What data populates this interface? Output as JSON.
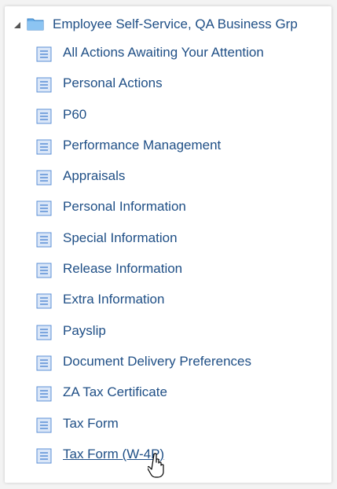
{
  "tree": {
    "root_label": "Employee Self-Service, QA Business Grp",
    "items": [
      {
        "label": "All Actions Awaiting Your Attention"
      },
      {
        "label": "Personal Actions"
      },
      {
        "label": "P60"
      },
      {
        "label": "Performance Management"
      },
      {
        "label": "Appraisals"
      },
      {
        "label": "Personal Information"
      },
      {
        "label": "Special Information"
      },
      {
        "label": "Release Information"
      },
      {
        "label": "Extra Information"
      },
      {
        "label": "Payslip"
      },
      {
        "label": "Document Delivery Preferences"
      },
      {
        "label": "ZA Tax Certificate"
      },
      {
        "label": "Tax Form"
      },
      {
        "label": "Tax Form (W-4P)"
      }
    ]
  },
  "colors": {
    "link": "#1f4f86",
    "folder": "#6aaee8",
    "doc": "#5b8fd6"
  },
  "icons": {
    "root": "folder-icon",
    "item": "document-icon",
    "expand": "expanded-triangle-icon"
  }
}
